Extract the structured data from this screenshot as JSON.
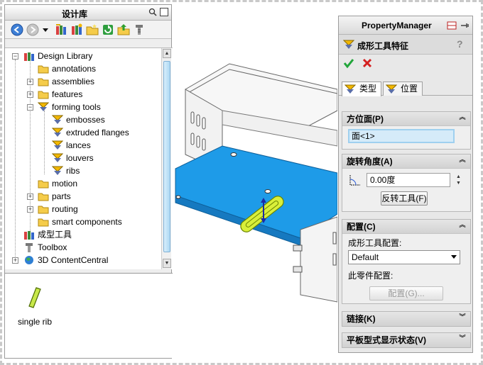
{
  "design_library": {
    "title": "设计库",
    "tree": [
      {
        "label": "Design Library"
      },
      {
        "label": "annotations"
      },
      {
        "label": "assemblies"
      },
      {
        "label": "features"
      },
      {
        "label": "forming tools"
      },
      {
        "label": "embosses"
      },
      {
        "label": "extruded flanges"
      },
      {
        "label": "lances"
      },
      {
        "label": "louvers"
      },
      {
        "label": "ribs"
      },
      {
        "label": "motion"
      },
      {
        "label": "parts"
      },
      {
        "label": "routing"
      },
      {
        "label": "smart components"
      },
      {
        "label": "成型工具"
      },
      {
        "label": "Toolbox"
      },
      {
        "label": "3D ContentCentral"
      }
    ],
    "preview_item": "single rib"
  },
  "property_manager": {
    "title": "PropertyManager",
    "feature_title": "成形工具特征",
    "help": "?",
    "tabs": [
      {
        "label": "类型"
      },
      {
        "label": "位置"
      }
    ],
    "orientation_face": {
      "header": "方位面(P)",
      "value": "面<1>"
    },
    "rotation_angle": {
      "header": "旋转角度(A)",
      "value": "0.00度",
      "reverse_button": "反转工具(F)"
    },
    "configuration": {
      "header": "配置(C)",
      "tool_config_label": "成形工具配置:",
      "tool_config_value": "Default",
      "part_config_label": "此零件配置:",
      "config_button": "配置(G)..."
    },
    "link": {
      "header": "链接(K)"
    },
    "flat_pattern": {
      "header": "平板型式显示状态(V)"
    }
  },
  "colors": {
    "face_blue": "#1e9be8",
    "pm_bg": "#e8e8e8",
    "selection": "#d5ebf9"
  }
}
